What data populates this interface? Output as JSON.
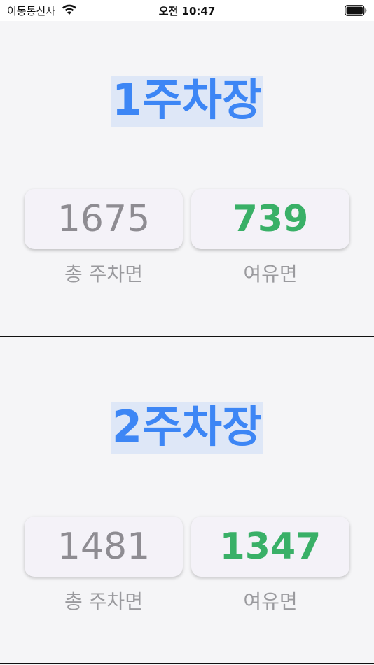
{
  "status_bar": {
    "carrier": "이동통신사",
    "time": "오전 10:47"
  },
  "lots": [
    {
      "title": "1주차장",
      "total_spaces": "1675",
      "total_label": "총 주차면",
      "available_spaces": "739",
      "available_label": "여유면"
    },
    {
      "title": "2주차장",
      "total_spaces": "1481",
      "total_label": "총 주차면",
      "available_spaces": "1347",
      "available_label": "여유면"
    }
  ],
  "colors": {
    "title": "#3d86f5",
    "available": "#39b067",
    "total": "#8e8c92",
    "caption": "#9a9a9e"
  },
  "icons": [
    "wifi-icon",
    "battery-icon"
  ]
}
